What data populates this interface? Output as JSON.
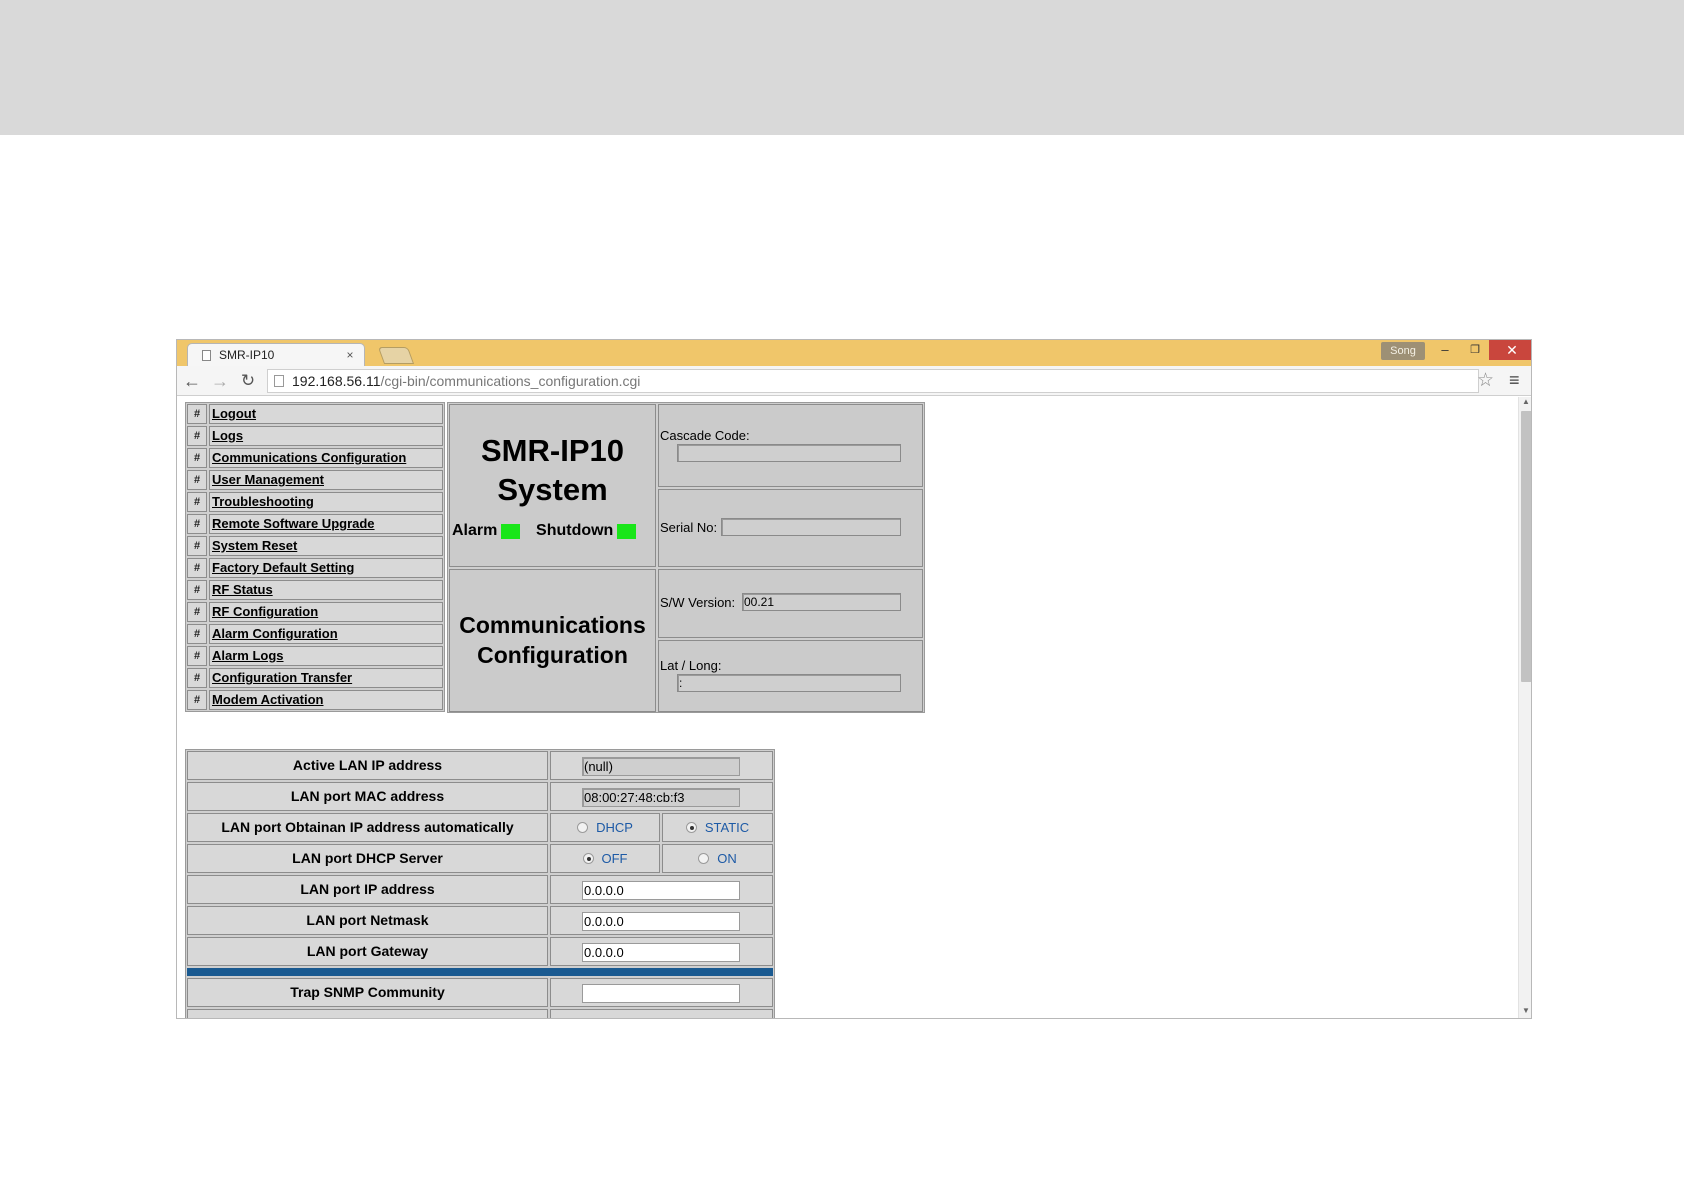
{
  "browser": {
    "tab_title": "SMR-IP10",
    "tab_close_glyph": "×",
    "user_name": "Song",
    "window_buttons": {
      "minimize": "–",
      "maximize": "❐",
      "close": "✕"
    },
    "url_host": "192.168.56.11",
    "url_path": "/cgi-bin/communications_configuration.cgi"
  },
  "menu": {
    "items": [
      {
        "hash": "#",
        "label": "Logout"
      },
      {
        "hash": "#",
        "label": "Logs"
      },
      {
        "hash": "#",
        "label": "Communications Configuration"
      },
      {
        "hash": "#",
        "label": "User Management"
      },
      {
        "hash": "#",
        "label": "Troubleshooting"
      },
      {
        "hash": "#",
        "label": "Remote Software Upgrade"
      },
      {
        "hash": "#",
        "label": "System Reset"
      },
      {
        "hash": "#",
        "label": "Factory Default Setting"
      },
      {
        "hash": "#",
        "label": "RF Status"
      },
      {
        "hash": "#",
        "label": "RF Configuration"
      },
      {
        "hash": "#",
        "label": "Alarm Configuration"
      },
      {
        "hash": "#",
        "label": "Alarm Logs"
      },
      {
        "hash": "#",
        "label": "Configuration Transfer"
      },
      {
        "hash": "#",
        "label": "Modem Activation"
      }
    ]
  },
  "system": {
    "title_line1": "SMR-IP10",
    "title_line2": "System",
    "alarm_label": "Alarm",
    "shutdown_label": "Shutdown",
    "led_color": "#19e619",
    "page_title_line1": "Communications",
    "page_title_line2": "Configuration"
  },
  "info": {
    "cascade_label": "Cascade Code:",
    "cascade_value": "",
    "serial_label": "Serial No:",
    "serial_value": "",
    "sw_label": "S/W Version:",
    "sw_value": "00.21",
    "latlong_label": "Lat / Long:",
    "latlong_value": ":"
  },
  "config": {
    "active_ip_label": "Active LAN IP address",
    "active_ip_value": "(null)",
    "mac_label": "LAN port MAC address",
    "mac_value": "08:00:27:48:cb:f3",
    "obtain_label": "LAN port Obtainan IP address automatically",
    "obtain_options": [
      "DHCP",
      "STATIC"
    ],
    "obtain_selected": "STATIC",
    "dhcp_server_label": "LAN port DHCP Server",
    "dhcp_server_options": [
      "OFF",
      "ON"
    ],
    "dhcp_server_selected": "OFF",
    "ip_label": "LAN port IP address",
    "ip_value": "0.0.0.0",
    "netmask_label": "LAN port Netmask",
    "netmask_value": "0.0.0.0",
    "gateway_label": "LAN port Gateway",
    "gateway_value": "0.0.0.0",
    "trap_label": "Trap SNMP Community",
    "trap_value": ""
  },
  "colors": {
    "titlebar": "#f0c66a",
    "divider_blue": "#1a5a91",
    "close_red": "#c9463d",
    "panel_gray": "#cfcfcf"
  }
}
